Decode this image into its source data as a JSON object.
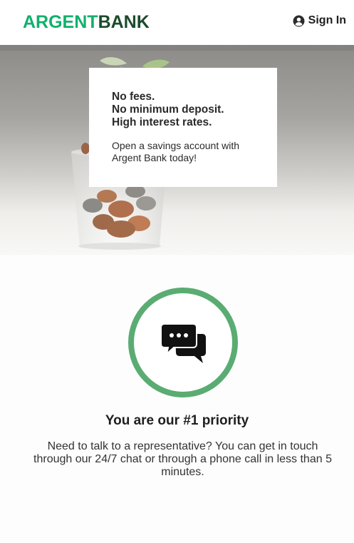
{
  "brand": {
    "name_part1": "ARGENT",
    "name_part2": "BANK",
    "primary_color": "#12b06c",
    "secondary_color": "#1b4b2c"
  },
  "header": {
    "signin_label": "Sign In",
    "signin_icon": "user-circle-icon"
  },
  "hero": {
    "lines": [
      "No fees.",
      "No minimum deposit.",
      "High interest rates."
    ],
    "subtext": "Open a savings account with Argent Bank today!"
  },
  "priority": {
    "icon": "chat-bubbles-icon",
    "ring_color": "#5aac72",
    "title": "You are our #1 priority",
    "text": "Need to talk to a representative? You can get in touch through our 24/7 chat or through a phone call in less than 5 minutes."
  }
}
